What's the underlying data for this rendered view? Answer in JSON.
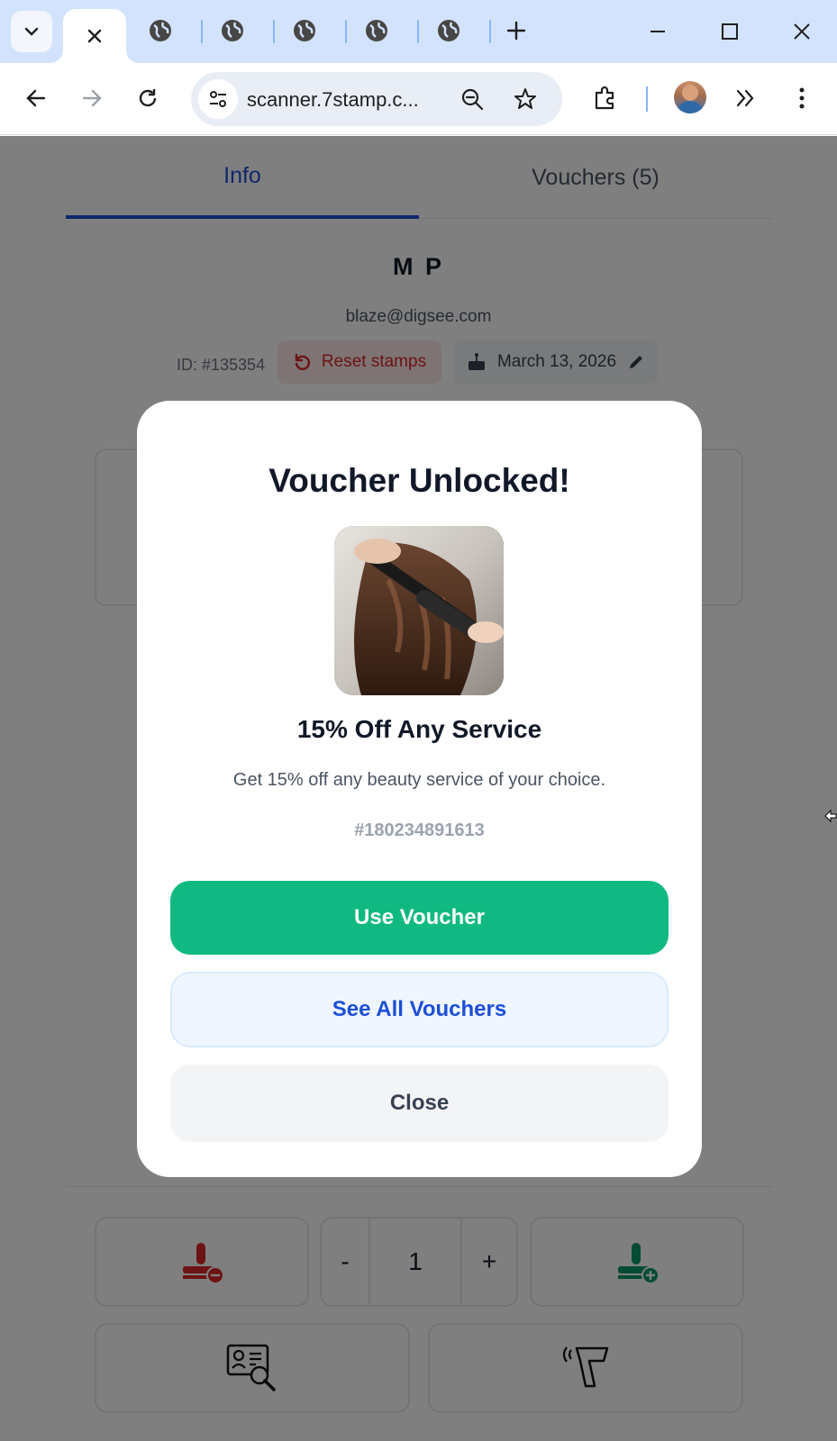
{
  "browser": {
    "url": "scanner.7stamp.c...",
    "colors": {
      "tabstrip": "#d3e3fd",
      "accent": "#8ab4f8"
    }
  },
  "page": {
    "tabs": [
      {
        "label": "Info",
        "active": true
      },
      {
        "label": "Vouchers (5)",
        "active": false
      }
    ],
    "customer": {
      "name": "M P",
      "email": "blaze@digsee.com",
      "id": "ID: #135354",
      "reset_label": "Reset stamps",
      "birthday": "March 13, 2026"
    },
    "stamp_quantity": {
      "minus": "-",
      "value": "1",
      "plus": "+"
    }
  },
  "modal": {
    "title": "Voucher Unlocked!",
    "voucher_name": "15% Off Any Service",
    "description": "Get 15% off any beauty service of your choice.",
    "code": "#180234891613",
    "buttons": {
      "use": "Use Voucher",
      "see_all": "See All Vouchers",
      "close": "Close"
    },
    "colors": {
      "primary": "#10b981",
      "link": "#1d4ed8",
      "danger": "#dc2626"
    }
  }
}
